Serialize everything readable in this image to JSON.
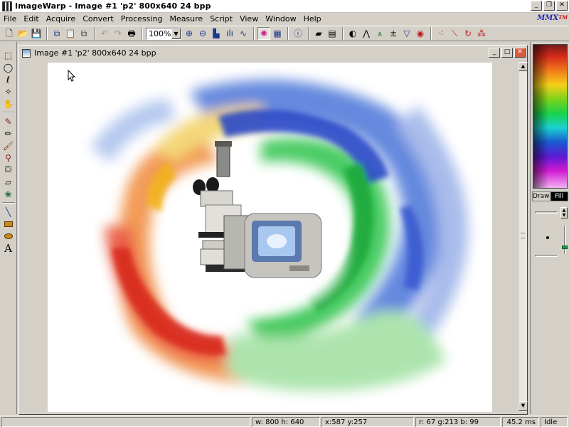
{
  "app": {
    "title": "ImageWarp - Image #1  'p2'  800x640  24  bpp",
    "window_controls": [
      "_",
      "❐",
      "✕"
    ]
  },
  "menu": {
    "items": [
      "File",
      "Edit",
      "Acquire",
      "Convert",
      "Processing",
      "Measure",
      "Script",
      "View",
      "Window",
      "Help"
    ],
    "brand": "MMX",
    "brand_sup": "TM"
  },
  "toolbar": {
    "zoom_value": "100%",
    "zoom_options": [
      "100%"
    ]
  },
  "image_window": {
    "title": "Image #1  'p2'  800x640  24  bpp"
  },
  "right_panel": {
    "tab_draw": "Draw",
    "tab_fill": "Fill",
    "active_tab": "Fill"
  },
  "status": {
    "size": "w: 800  h: 640",
    "coords": "x:587  y:257",
    "rgb": "r: 67  g:213  b: 99",
    "timing": "45.2 ms",
    "state": "Idle"
  },
  "colors": {
    "close_button": "#d85b3c",
    "active_tab_bg": "#000000",
    "brand_blue": "#1b2ab3",
    "brand_red": "#c31a1a"
  }
}
